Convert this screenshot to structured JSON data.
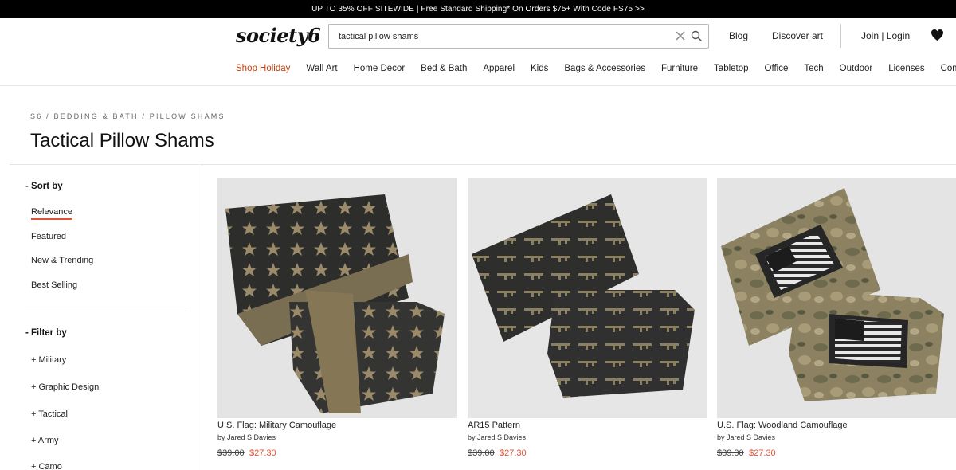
{
  "promo": "UP TO 35% OFF SITEWIDE | Free Standard Shipping* On Orders $75+ With Code FS75 >>",
  "header": {
    "logo": "society6",
    "search_value": "tactical pillow shams",
    "blog": "Blog",
    "discover": "Discover art",
    "join": "Join | Login"
  },
  "nav": [
    "Shop Holiday",
    "Wall Art",
    "Home Decor",
    "Bed & Bath",
    "Apparel",
    "Kids",
    "Bags & Accessories",
    "Furniture",
    "Tabletop",
    "Office",
    "Tech",
    "Outdoor",
    "Licenses",
    "Comm"
  ],
  "breadcrumb": "S6 / BEDDING & BATH / PILLOW SHAMS",
  "page_title": "Tactical Pillow Shams",
  "sidebar": {
    "sort_heading": "- Sort by",
    "sort_items": [
      "Relevance",
      "Featured",
      "New & Trending",
      "Best Selling"
    ],
    "filter_heading": "- Filter by",
    "filter_items": [
      "+ Military",
      "+ Graphic Design",
      "+ Tactical",
      "+ Army",
      "+ Camo"
    ]
  },
  "products": [
    {
      "name": "U.S. Flag: Military Camouflage",
      "artist": "by Jared S Davies",
      "old_price": "$39.00",
      "price": "$27.30"
    },
    {
      "name": "AR15 Pattern",
      "artist": "by Jared S Davies",
      "old_price": "$39.00",
      "price": "$27.30"
    },
    {
      "name": "U.S. Flag: Woodland Camouflage",
      "artist": "by Jared S Davies",
      "old_price": "$39.00",
      "price": "$27.30"
    }
  ],
  "colors": {
    "accent": "#c2410c",
    "sale": "#e0553a",
    "promo_bg": "#000000"
  }
}
